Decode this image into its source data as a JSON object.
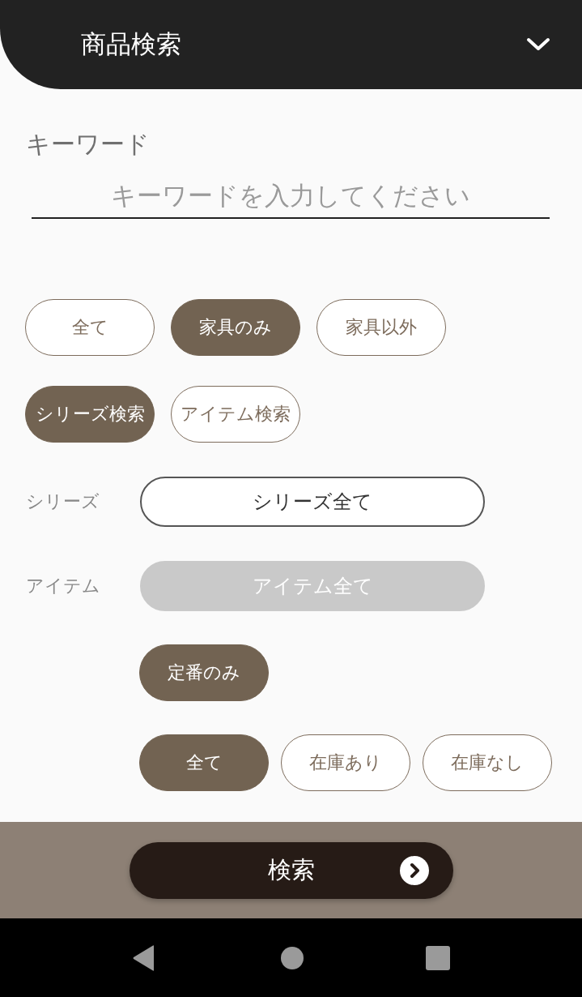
{
  "header": {
    "title": "商品検索"
  },
  "keyword": {
    "label": "キーワード",
    "placeholder": "キーワードを入力してください"
  },
  "category_filter": [
    {
      "label": "全て",
      "selected": false
    },
    {
      "label": "家具のみ",
      "selected": true
    },
    {
      "label": "家具以外",
      "selected": false
    }
  ],
  "search_mode": [
    {
      "label": "シリーズ検索",
      "selected": true
    },
    {
      "label": "アイテム検索",
      "selected": false
    }
  ],
  "selects": [
    {
      "label": "シリーズ",
      "value": "シリーズ全て",
      "disabled": false
    },
    {
      "label": "アイテム",
      "value": "アイテム全て",
      "disabled": true
    }
  ],
  "standard_only": {
    "label": "定番のみ",
    "selected": true
  },
  "stock_filter": [
    {
      "label": "全て",
      "selected": true
    },
    {
      "label": "在庫あり",
      "selected": false
    },
    {
      "label": "在庫なし",
      "selected": false
    }
  ],
  "search_button": {
    "label": "検索"
  }
}
